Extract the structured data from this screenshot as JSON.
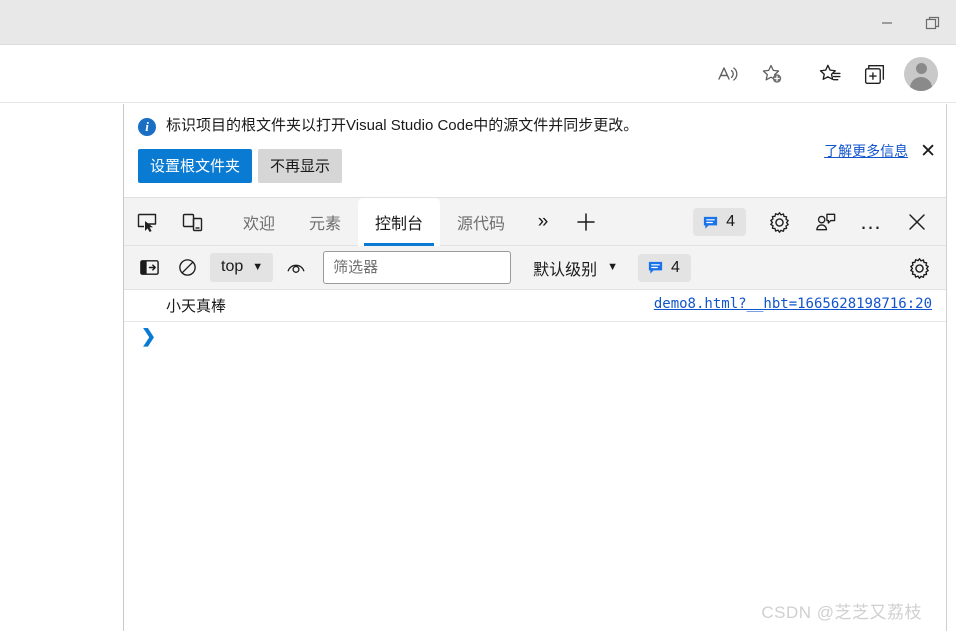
{
  "window": {
    "minimize_label": "最小化",
    "restore_label": "还原"
  },
  "browser_toolbar": {
    "read_aloud": "朗读此页内容",
    "add_favorite": "添加到收藏夹",
    "favorites": "收藏夹",
    "collections": "集锦",
    "profile": "个人资料"
  },
  "banner": {
    "icon": "info-icon",
    "message": "标识项目的根文件夹以打开Visual Studio Code中的源文件并同步更改。",
    "primary_button": "设置根文件夹",
    "secondary_button": "不再显示",
    "learn_more": "了解更多信息",
    "close": "✕",
    "primary_color": "#0a7bd3",
    "link_color": "#1155cc"
  },
  "devtools": {
    "inspect_icon": "inspect-element-icon",
    "device_icon": "device-toolbar-icon",
    "tabs": [
      {
        "label": "欢迎",
        "active": false
      },
      {
        "label": "元素",
        "active": false
      },
      {
        "label": "控制台",
        "active": true
      },
      {
        "label": "源代码",
        "active": false
      }
    ],
    "more_tabs": "»",
    "add_tab": "+",
    "issues_count": "4",
    "settings": "设置",
    "feedback": "反馈",
    "more_options": "…",
    "close": "✕",
    "active_tab_underline": "#0a7bd3"
  },
  "console_toolbar": {
    "sidebar_icon": "console-sidebar-icon",
    "clear_icon": "clear-console-icon",
    "context": "top",
    "context_caret": "▼",
    "eye_icon": "live-expression-icon",
    "filter_placeholder": "筛选器",
    "filter_value": "",
    "level": "默认级别",
    "level_caret": "▼",
    "issues_count": "4",
    "settings": "控制台设置"
  },
  "console": {
    "messages": [
      {
        "text": "小天真棒",
        "source": "demo8.html?__hbt=1665628198716:20"
      }
    ],
    "prompt": "❯"
  },
  "watermark": "CSDN @芝芝又荔枝"
}
